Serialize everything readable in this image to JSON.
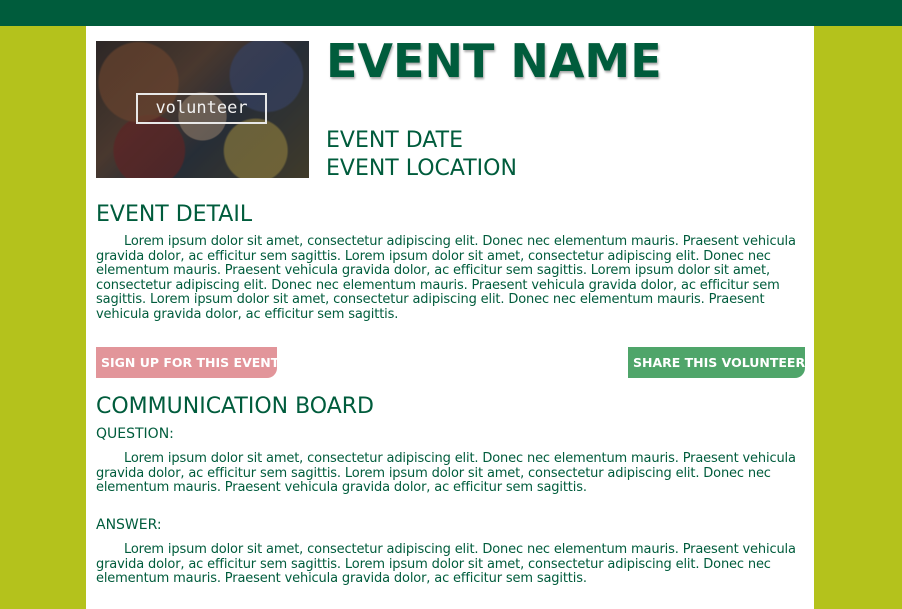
{
  "event": {
    "name": "EVENT NAME",
    "date": "EVENT DATE",
    "location": "EVENT LOCATION",
    "image_label": "volunteer"
  },
  "detail": {
    "heading": "EVENT DETAIL",
    "text": "Lorem ipsum dolor sit amet, consectetur adipiscing elit. Donec nec elementum mauris. Praesent vehicula gravida dolor, ac efficitur sem sagittis. Lorem ipsum dolor sit amet, consectetur adipiscing elit. Donec nec elementum mauris. Praesent vehicula gravida dolor, ac efficitur sem sagittis. Lorem ipsum dolor sit amet, consectetur adipiscing elit. Donec nec elementum mauris. Praesent vehicula gravida dolor, ac efficitur sem sagittis. Lorem ipsum dolor sit amet, consectetur adipiscing elit. Donec nec elementum mauris. Praesent vehicula gravida dolor, ac efficitur sem sagittis."
  },
  "actions": {
    "signup_label": "SIGN UP FOR THIS EVENT",
    "share_label": "SHARE THIS VOLUNTEER"
  },
  "board": {
    "heading": "COMMUNICATION BOARD",
    "question_label": "QUESTION:",
    "question_text": "Lorem ipsum dolor sit amet, consectetur adipiscing elit. Donec nec elementum mauris. Praesent vehicula gravida dolor, ac efficitur sem sagittis. Lorem ipsum dolor sit amet, consectetur adipiscing elit. Donec nec elementum mauris. Praesent vehicula gravida dolor, ac efficitur sem sagittis.",
    "answer_label": "ANSWER:",
    "answer_text": "Lorem ipsum dolor sit amet, consectetur adipiscing elit. Donec nec elementum mauris. Praesent vehicula gravida dolor, ac efficitur sem sagittis. Lorem ipsum dolor sit amet, consectetur adipiscing elit. Donec nec elementum mauris. Praesent vehicula gravida dolor, ac efficitur sem sagittis."
  },
  "colors": {
    "background": "#b4c21c",
    "header_bar": "#005c3c",
    "text": "#005c3c",
    "signup_button": "#e2959a",
    "share_button": "#4fa56a"
  }
}
